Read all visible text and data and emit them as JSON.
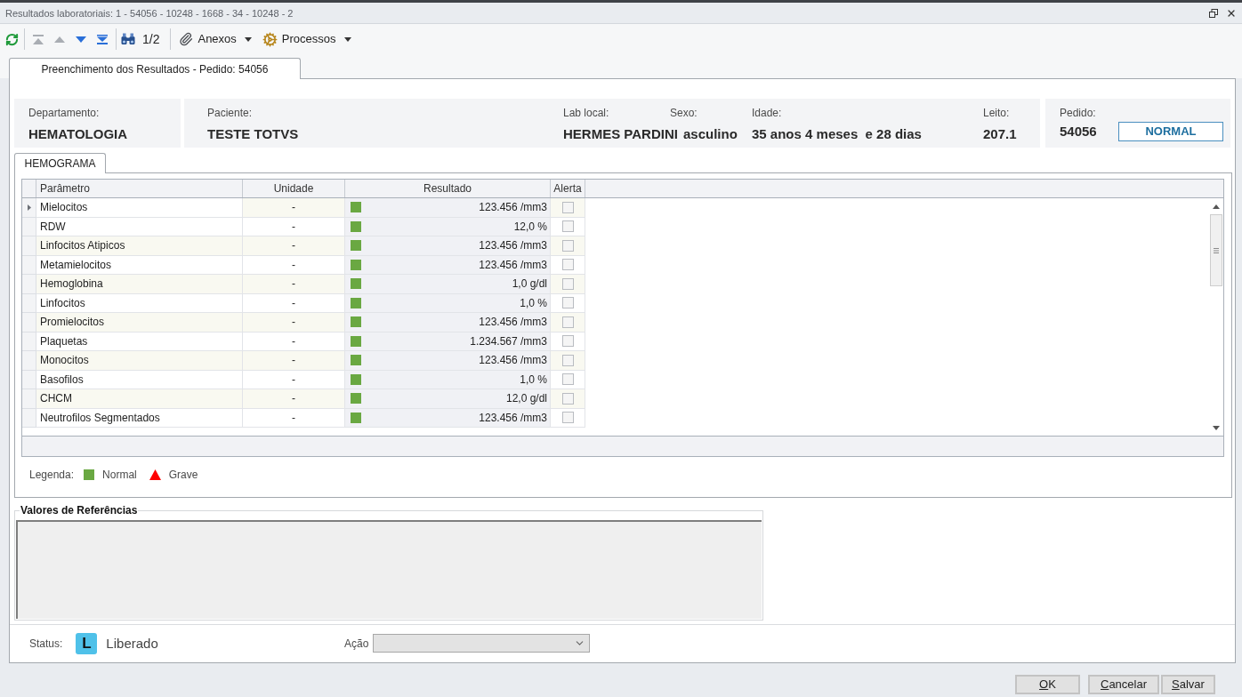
{
  "window": {
    "title": "Resultados laboratoriais: 1 - 54056 - 10248 - 1668 - 34 - 10248 - 2"
  },
  "toolbar": {
    "navigation": [
      {
        "kind": "first",
        "disabled": true
      },
      {
        "kind": "prev",
        "disabled": true
      },
      {
        "kind": "next",
        "disabled": false
      },
      {
        "kind": "last",
        "disabled": false
      }
    ],
    "page": "1/2",
    "menus": [
      {
        "kind": "attachments",
        "label": "Anexos"
      },
      {
        "kind": "processes",
        "label": "Processos"
      }
    ]
  },
  "tabs": [
    {
      "label": "Preenchimento dos Resultados - Pedido: 54056",
      "selected": true
    }
  ],
  "header": {
    "departamento": {
      "label": "Departamento:",
      "value": "HEMATOLOGIA"
    },
    "paciente": {
      "label": "Paciente:",
      "value": "TESTE TOTVS"
    },
    "lab_local": {
      "label": "Lab local:",
      "value": "HERMES PARDINI"
    },
    "sexo": {
      "label": "Sexo:",
      "value": "asculino"
    },
    "idade": {
      "label": "Idade:",
      "value": "35 anos 4 meses  e 28 dias"
    },
    "leito": {
      "label": "Leito:",
      "value": "207.1"
    },
    "pedido": {
      "label": "Pedido:",
      "value": "54056",
      "priority": "NORMAL"
    }
  },
  "exam_tabs": [
    {
      "label": "HEMOGRAMA",
      "selected": true
    }
  ],
  "grid": {
    "columns": [
      "Parâmetro",
      "Unidade",
      "Resultado",
      "Alerta"
    ],
    "rows": [
      {
        "parametro": "Mielocitos",
        "unidade": "-",
        "resultado": "123.456 /mm3",
        "color": "#6aa842",
        "alerta": false,
        "selected": true
      },
      {
        "parametro": "RDW",
        "unidade": "-",
        "resultado": "12,0 %",
        "color": "#6aa842",
        "alerta": false,
        "selected": false
      },
      {
        "parametro": "Linfocitos Atipicos",
        "unidade": "-",
        "resultado": "123.456 /mm3",
        "color": "#6aa842",
        "alerta": false,
        "selected": false
      },
      {
        "parametro": "Metamielocitos",
        "unidade": "-",
        "resultado": "123.456 /mm3",
        "color": "#6aa842",
        "alerta": false,
        "selected": false
      },
      {
        "parametro": "Hemoglobina",
        "unidade": "-",
        "resultado": "1,0 g/dl",
        "color": "#6aa842",
        "alerta": false,
        "selected": false
      },
      {
        "parametro": "Linfocitos",
        "unidade": "-",
        "resultado": "1,0 %",
        "color": "#6aa842",
        "alerta": false,
        "selected": false
      },
      {
        "parametro": "Promielocitos",
        "unidade": "-",
        "resultado": "123.456 /mm3",
        "color": "#6aa842",
        "alerta": false,
        "selected": false
      },
      {
        "parametro": "Plaquetas",
        "unidade": "-",
        "resultado": "1.234.567 /mm3",
        "color": "#6aa842",
        "alerta": false,
        "selected": false
      },
      {
        "parametro": "Monocitos",
        "unidade": "-",
        "resultado": "123.456 /mm3",
        "color": "#6aa842",
        "alerta": false,
        "selected": false
      },
      {
        "parametro": "Basofilos",
        "unidade": "-",
        "resultado": "1,0 %",
        "color": "#6aa842",
        "alerta": false,
        "selected": false
      },
      {
        "parametro": "CHCM",
        "unidade": "-",
        "resultado": "12,0 g/dl",
        "color": "#6aa842",
        "alerta": false,
        "selected": false
      },
      {
        "parametro": "Neutrofilos Segmentados",
        "unidade": "-",
        "resultado": "123.456 /mm3",
        "color": "#6aa842",
        "alerta": false,
        "selected": false
      }
    ]
  },
  "legend": {
    "label": "Legenda:",
    "items": [
      {
        "kind": "normal",
        "label": "Normal"
      },
      {
        "kind": "grave",
        "label": "Grave"
      }
    ]
  },
  "reference": {
    "title": "Valores de Referências"
  },
  "status": {
    "label": "Status:",
    "badge": "L",
    "value": "Liberado"
  },
  "action": {
    "label": "Ação",
    "disabled": true
  },
  "buttons": [
    "OK",
    "Cancelar",
    "Salvar"
  ]
}
